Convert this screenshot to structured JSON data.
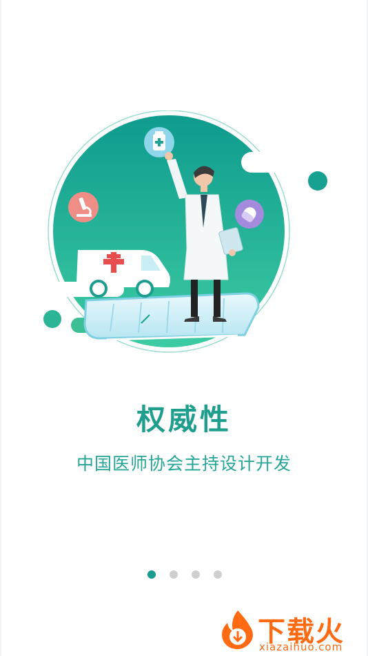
{
  "slide": {
    "title": "权威性",
    "subtitle": "中国医师协会主持设计开发"
  },
  "pagination": {
    "total": 4,
    "active_index": 0
  },
  "watermark": {
    "title": "下载火",
    "url": "xiazaihuo.com"
  },
  "icons": [
    "medicine-bottle-icon",
    "microscope-icon",
    "pill-capsule-icon",
    "ambulance",
    "doctor-figure"
  ],
  "colors": {
    "primary": "#1f9e8e",
    "circle_gradient_top": "#0f9b8e",
    "circle_gradient_bottom": "#38c7a0",
    "dot_active": "#169b8c",
    "dot_inactive": "#cfcfcf",
    "watermark": "#ff6a12"
  }
}
